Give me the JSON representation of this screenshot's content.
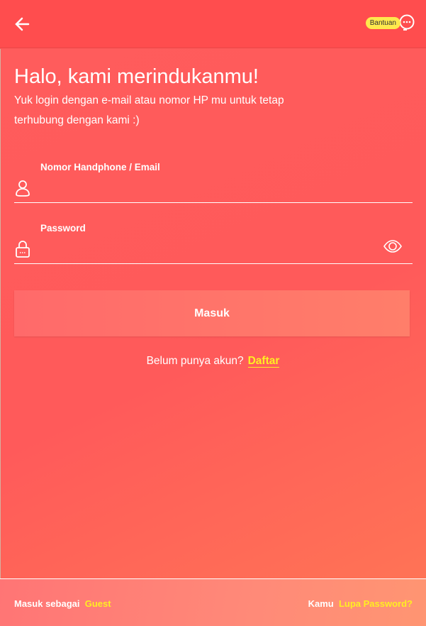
{
  "header": {
    "help_label": "Bantuan"
  },
  "greeting": {
    "title": "Halo, kami merindukanmu!",
    "subtitle": "Yuk login dengan e-mail atau nomor HP mu untuk tetap terhubung dengan kami :)"
  },
  "form": {
    "identity": {
      "label": "Nomor Handphone / Email",
      "value": ""
    },
    "password": {
      "label": "Password",
      "value": ""
    },
    "submit_label": "Masuk"
  },
  "register": {
    "prompt": "Belum punya akun?",
    "link": "Daftar"
  },
  "footer": {
    "guest_prompt": "Masuk sebagai",
    "guest_link": "Guest",
    "forgot_prompt": "Kamu",
    "forgot_link": "Lupa Password?"
  },
  "colors": {
    "accent_link": "#ffee22"
  }
}
